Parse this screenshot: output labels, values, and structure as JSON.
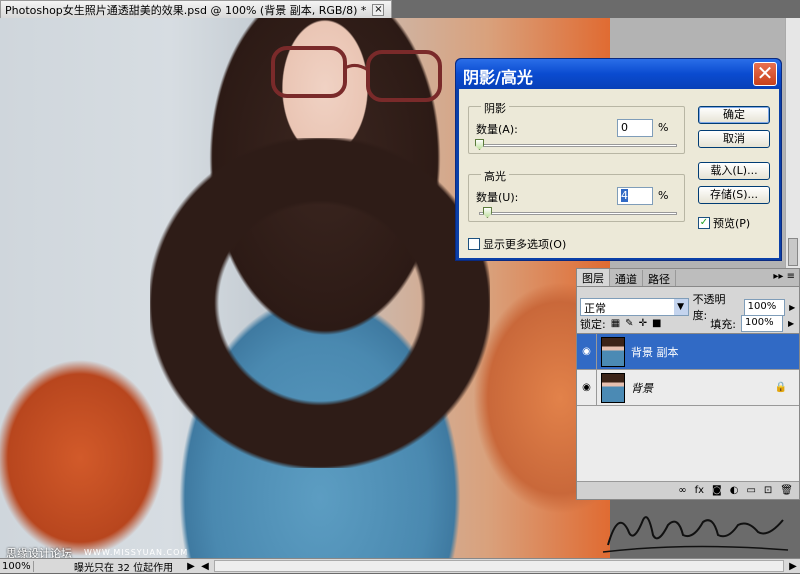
{
  "document": {
    "tab_title": "Photoshop女生照片通透甜美的效果.psd @ 100% (背景 副本, RGB/8) *",
    "close_glyph": "×"
  },
  "dialog": {
    "title": "阴影/高光",
    "close_glyph": "✕",
    "shadows": {
      "legend": "阴影",
      "amount_label": "数量(A):",
      "amount_value": "0",
      "unit": "%",
      "slider_fraction": 0.0
    },
    "highlights": {
      "legend": "高光",
      "amount_label": "数量(U):",
      "amount_value": "4",
      "unit": "%",
      "slider_fraction": 0.04
    },
    "show_more": {
      "label": "显示更多选项(O)",
      "checked": false
    },
    "buttons": {
      "ok": "确定",
      "cancel": "取消",
      "load": "载入(L)...",
      "save": "存储(S)..."
    },
    "preview": {
      "label": "预览(P)",
      "checked": true,
      "check_glyph": "✓"
    }
  },
  "layers_panel": {
    "tabs": [
      "图层",
      "通道",
      "路径"
    ],
    "menu_glyph": "▸▸ ≡",
    "blend_mode": "正常",
    "opacity_label": "不透明度:",
    "opacity_value": "100%",
    "lock_label": "锁定:",
    "fill_label": "填充:",
    "fill_value": "100%",
    "layers": [
      {
        "name": "背景 副本",
        "selected": true,
        "visible": true
      },
      {
        "name": "背景",
        "selected": false,
        "visible": true,
        "locked": true
      }
    ],
    "bottom_icons": [
      "link-icon",
      "fx-icon",
      "mask-icon",
      "adjustment-icon",
      "group-icon",
      "new-layer-icon",
      "trash-icon"
    ]
  },
  "status_bar": {
    "zoom": "100%",
    "info": "曝光只在 32 位起作用"
  },
  "watermark": {
    "text": "思缘设计论坛",
    "site": "WWW.MISSYUAN.COM",
    "signature": "Huoshanizuo"
  },
  "colors": {
    "dialog_title": "#0a4bd0",
    "selection": "#316ac5",
    "panel_bg": "#d6d6d6"
  }
}
